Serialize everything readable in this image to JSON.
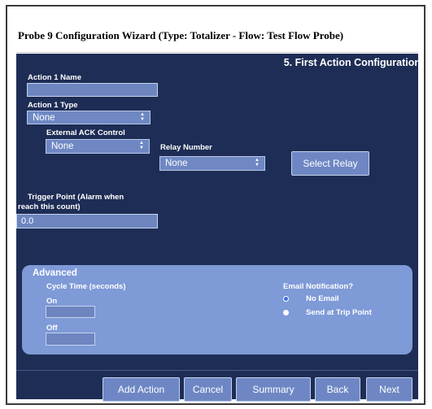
{
  "wizard": {
    "title": "Probe 9 Configuration Wizard (Type: Totalizer - Flow: Test Flow Probe)",
    "step_title": "5. First Action Configuration"
  },
  "form": {
    "action_name_label": "Action 1 Name",
    "action_name_value": "",
    "action_type_label": "Action 1 Type",
    "action_type_value": "None",
    "ack_label": "External ACK Control",
    "ack_value": "None",
    "relay_label": "Relay Number",
    "relay_value": "None",
    "select_relay_label": "Select Relay",
    "trigger_label_line1": "Trigger Point (Alarm when",
    "trigger_label_line2": "reach this count)",
    "trigger_value": "0.0"
  },
  "advanced": {
    "title": "Advanced",
    "cycle_label": "Cycle Time (seconds)",
    "on_label": "On",
    "on_value": "",
    "off_label": "Off",
    "off_value": "",
    "email_label": "Email Notification?",
    "email_options": [
      {
        "label": "No Email",
        "selected": true
      },
      {
        "label": "Send at Trip Point",
        "selected": false
      }
    ]
  },
  "buttons": {
    "add_action": "Add Action",
    "cancel": "Cancel",
    "summary": "Summary",
    "back": "Back",
    "next": "Next"
  },
  "colors": {
    "panel": "#1e2d55",
    "advanced_panel": "#7e9ad7",
    "control": "#6e87c4"
  },
  "icons": {
    "select_arrow": "updown-chevron-icon",
    "radio": "radio-icon"
  }
}
